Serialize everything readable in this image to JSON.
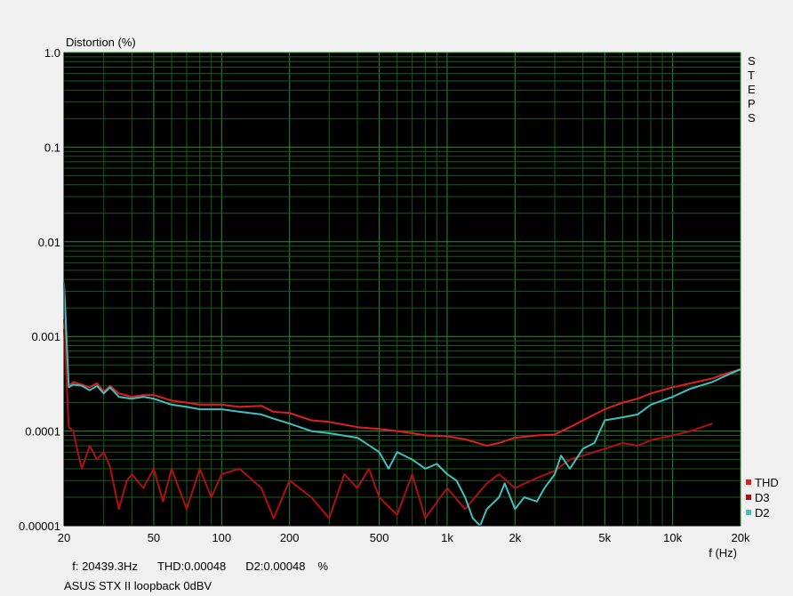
{
  "chart_data": {
    "type": "line",
    "title": "Distortion (%)",
    "xlabel": "f (Hz)",
    "xscale": "log",
    "yscale": "log",
    "xlim": [
      20,
      20000
    ],
    "ylim": [
      1e-05,
      1.0
    ],
    "grid": true,
    "background": "#000000",
    "grid_color_major": "#2f8a2f",
    "grid_color_minor": "#1c5a1c",
    "x_ticks": [
      {
        "v": 20,
        "label": "20"
      },
      {
        "v": 50,
        "label": "50"
      },
      {
        "v": 100,
        "label": "100"
      },
      {
        "v": 200,
        "label": "200"
      },
      {
        "v": 500,
        "label": "500"
      },
      {
        "v": 1000,
        "label": "1k"
      },
      {
        "v": 2000,
        "label": "2k"
      },
      {
        "v": 5000,
        "label": "5k"
      },
      {
        "v": 10000,
        "label": "10k"
      },
      {
        "v": 20000,
        "label": "20k"
      }
    ],
    "y_ticks": [
      {
        "v": 1.0,
        "label": "1.0"
      },
      {
        "v": 0.1,
        "label": "0.1"
      },
      {
        "v": 0.01,
        "label": "0.01"
      },
      {
        "v": 0.001,
        "label": "0.001"
      },
      {
        "v": 0.0001,
        "label": "0.0001"
      },
      {
        "v": 1e-05,
        "label": "0.00001"
      }
    ],
    "side_label": [
      "S",
      "T",
      "E",
      "P",
      "S"
    ],
    "legend_position": "bottom-right",
    "series": [
      {
        "name": "THD",
        "color": "#e02020",
        "x": [
          20,
          21,
          22,
          24,
          26,
          28,
          30,
          32,
          35,
          40,
          45,
          50,
          60,
          70,
          80,
          100,
          120,
          150,
          170,
          200,
          250,
          300,
          400,
          500,
          600,
          700,
          800,
          1000,
          1200,
          1500,
          1700,
          2000,
          2500,
          3000,
          3500,
          4000,
          5000,
          6000,
          7000,
          8000,
          10000,
          12000,
          15000,
          17000,
          20000
        ],
        "y": [
          0.0015,
          0.0003,
          0.00033,
          0.00031,
          0.00029,
          0.00032,
          0.00026,
          0.0003,
          0.00025,
          0.00023,
          0.00024,
          0.00024,
          0.00021,
          0.0002,
          0.00019,
          0.00019,
          0.00018,
          0.000185,
          0.00016,
          0.000155,
          0.00013,
          0.000125,
          0.00011,
          0.000105,
          0.0001,
          9.5e-05,
          9e-05,
          8.8e-05,
          8.2e-05,
          7e-05,
          7.5e-05,
          8.5e-05,
          9e-05,
          9.2e-05,
          0.00011,
          0.00013,
          0.00017,
          0.0002,
          0.00022,
          0.00025,
          0.00029,
          0.00032,
          0.00036,
          0.0004,
          0.00045
        ]
      },
      {
        "name": "D3",
        "color": "#b01010",
        "x": [
          20,
          21,
          22,
          23,
          24,
          26,
          28,
          30,
          32,
          35,
          38,
          40,
          45,
          50,
          55,
          60,
          70,
          80,
          90,
          100,
          120,
          150,
          170,
          200,
          250,
          300,
          350,
          400,
          450,
          500,
          600,
          700,
          800,
          1000,
          1200,
          1500,
          1700,
          2000,
          2500,
          3000,
          3500,
          4000,
          5000,
          6000,
          7000,
          8000,
          10000,
          12000,
          15000
        ],
        "y": [
          0.0012,
          0.00011,
          0.0001,
          6e-05,
          4e-05,
          7e-05,
          5e-05,
          6e-05,
          4.2e-05,
          1.5e-05,
          3e-05,
          3.5e-05,
          2.5e-05,
          4e-05,
          1.8e-05,
          4e-05,
          1.5e-05,
          4e-05,
          2e-05,
          3.5e-05,
          4e-05,
          2.5e-05,
          1.2e-05,
          3e-05,
          2e-05,
          1.2e-05,
          3.5e-05,
          2.5e-05,
          4e-05,
          2e-05,
          1.3e-05,
          3.5e-05,
          1.2e-05,
          2.5e-05,
          1.5e-05,
          2.8e-05,
          3.5e-05,
          2.5e-05,
          3.2e-05,
          3.8e-05,
          5e-05,
          5.5e-05,
          6.5e-05,
          7.5e-05,
          7e-05,
          8e-05,
          9e-05,
          0.0001,
          0.00012
        ]
      },
      {
        "name": "D2",
        "color": "#40c0c0",
        "x": [
          20,
          21,
          22,
          24,
          26,
          28,
          30,
          32,
          35,
          40,
          45,
          50,
          60,
          70,
          80,
          100,
          120,
          150,
          170,
          200,
          250,
          300,
          400,
          500,
          550,
          600,
          700,
          800,
          900,
          1000,
          1100,
          1200,
          1300,
          1400,
          1500,
          1700,
          1800,
          2000,
          2200,
          2500,
          2700,
          3000,
          3200,
          3500,
          4000,
          4500,
          5000,
          6000,
          7000,
          8000,
          10000,
          12000,
          15000,
          17000,
          20000
        ],
        "y": [
          0.0037,
          0.00029,
          0.00031,
          0.0003,
          0.00027,
          0.0003,
          0.00025,
          0.00029,
          0.00023,
          0.00022,
          0.00023,
          0.00022,
          0.00019,
          0.00018,
          0.00017,
          0.00017,
          0.00016,
          0.00015,
          0.000135,
          0.00012,
          0.0001,
          9.5e-05,
          8.5e-05,
          6e-05,
          4e-05,
          6e-05,
          5e-05,
          4e-05,
          4.5e-05,
          3.5e-05,
          3e-05,
          2e-05,
          1.2e-05,
          1e-05,
          1.5e-05,
          2e-05,
          2.8e-05,
          1.5e-05,
          2e-05,
          1.8e-05,
          2.5e-05,
          3.5e-05,
          5.5e-05,
          4e-05,
          6.5e-05,
          7.5e-05,
          0.00013,
          0.00014,
          0.00015,
          0.00019,
          0.00023,
          0.00028,
          0.00033,
          0.00038,
          0.00045
        ]
      }
    ]
  },
  "status": {
    "frequency": "f: 20439.3Hz",
    "thd": "THD:0.00048",
    "d2": "D2:0.00048",
    "unit": "%"
  },
  "caption": "ASUS STX II loopback 0dBV"
}
